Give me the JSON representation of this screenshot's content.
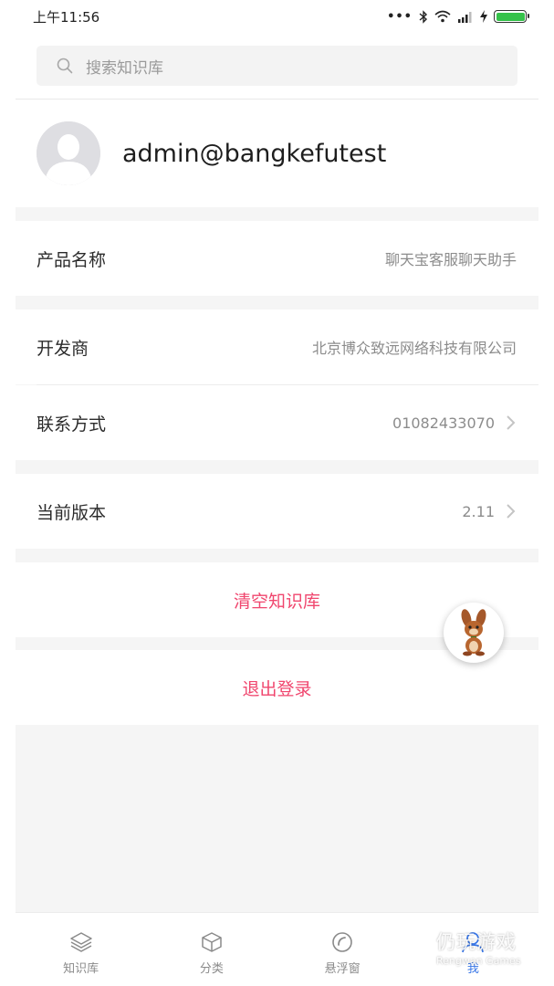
{
  "status_bar": {
    "time": "上午11:56",
    "icons": [
      "dots-icon",
      "bluetooth-icon",
      "wifi-icon",
      "signal-icon",
      "charging-icon",
      "battery-icon"
    ],
    "battery_color": "#35c24a"
  },
  "search": {
    "placeholder": "搜索知识库"
  },
  "profile": {
    "username": "admin@bangkefutest"
  },
  "info_rows": [
    {
      "label": "产品名称",
      "value": "聊天宝客服聊天助手",
      "has_chevron": false
    },
    {
      "label": "开发商",
      "value": "北京博众致远网络科技有限公司",
      "has_chevron": false
    },
    {
      "label": "联系方式",
      "value": "01082433070",
      "has_chevron": true
    },
    {
      "label": "当前版本",
      "value": "2.11",
      "has_chevron": true
    }
  ],
  "actions": {
    "clear_kb": "清空知识库",
    "logout": "退出登录",
    "accent_color": "#f0466e"
  },
  "tabbar": {
    "tabs": [
      {
        "label": "知识库",
        "icon": "layers-icon",
        "active": false
      },
      {
        "label": "分类",
        "icon": "cube-icon",
        "active": false
      },
      {
        "label": "悬浮窗",
        "icon": "floating-window-icon",
        "active": false
      },
      {
        "label": "我",
        "icon": "person-icon",
        "active": true
      }
    ],
    "active_color": "#3b78e7"
  },
  "watermark": {
    "main": "仍玩游戏",
    "sub": "Rengwan Games"
  }
}
